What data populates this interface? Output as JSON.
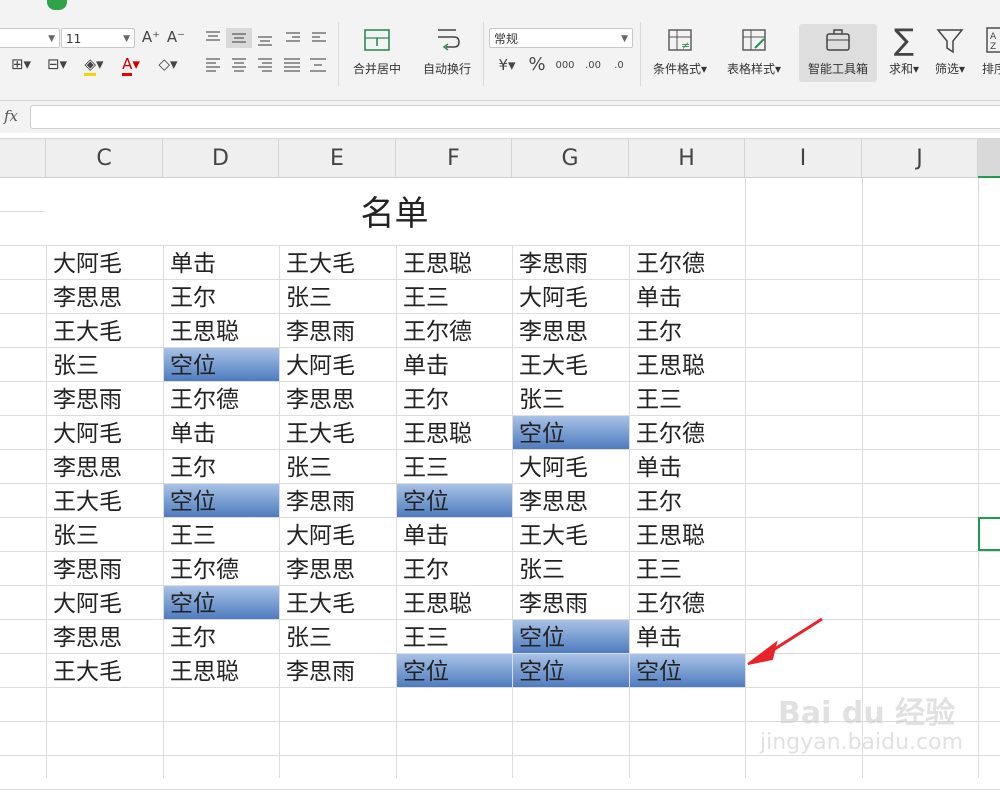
{
  "ribbon": {
    "font_size": "11",
    "number_format": "常规",
    "merge_center": "合并居中",
    "wrap_text": "自动换行",
    "conditional_format": "条件格式",
    "table_style": "表格样式",
    "smart_toolbox": "智能工具箱",
    "sum": "求和",
    "filter": "筛选",
    "sort": "排序",
    "percent": "%",
    "thousands": "000",
    "dec_inc": ".00",
    "dec_dec": ".0"
  },
  "formula_bar": {
    "fx_label": "fx",
    "value": ""
  },
  "columns": [
    "C",
    "D",
    "E",
    "F",
    "G",
    "H",
    "I",
    "J"
  ],
  "sheet": {
    "title": "名单",
    "rows": [
      [
        "大阿毛",
        "单击",
        "王大毛",
        "王思聪",
        "李思雨",
        "王尔德"
      ],
      [
        "李思思",
        "王尔",
        "张三",
        "王三",
        "大阿毛",
        "单击"
      ],
      [
        "王大毛",
        "王思聪",
        "李思雨",
        "王尔德",
        "李思思",
        "王尔"
      ],
      [
        "张三",
        "空位",
        "大阿毛",
        "单击",
        "王大毛",
        "王思聪"
      ],
      [
        "李思雨",
        "王尔德",
        "李思思",
        "王尔",
        "张三",
        "王三"
      ],
      [
        "大阿毛",
        "单击",
        "王大毛",
        "王思聪",
        "空位",
        "王尔德"
      ],
      [
        "李思思",
        "王尔",
        "张三",
        "王三",
        "大阿毛",
        "单击"
      ],
      [
        "王大毛",
        "空位",
        "李思雨",
        "空位",
        "李思思",
        "王尔"
      ],
      [
        "张三",
        "王三",
        "大阿毛",
        "单击",
        "王大毛",
        "王思聪"
      ],
      [
        "李思雨",
        "王尔德",
        "李思思",
        "王尔",
        "张三",
        "王三"
      ],
      [
        "大阿毛",
        "空位",
        "王大毛",
        "王思聪",
        "李思雨",
        "王尔德"
      ],
      [
        "李思思",
        "王尔",
        "张三",
        "王三",
        "空位",
        "单击"
      ],
      [
        "王大毛",
        "王思聪",
        "李思雨",
        "空位",
        "空位",
        "空位"
      ]
    ],
    "highlighted_cells": [
      [
        3,
        1
      ],
      [
        5,
        4
      ],
      [
        7,
        1
      ],
      [
        7,
        3
      ],
      [
        10,
        1
      ],
      [
        11,
        4
      ],
      [
        12,
        3
      ],
      [
        12,
        4
      ],
      [
        12,
        5
      ]
    ],
    "highlight_color": "#6f95cc"
  },
  "annotation": {
    "arrow_color": "#e8232a"
  },
  "watermark": {
    "brand": "Bai du 经验",
    "url": "jingyan.baidu.com"
  }
}
